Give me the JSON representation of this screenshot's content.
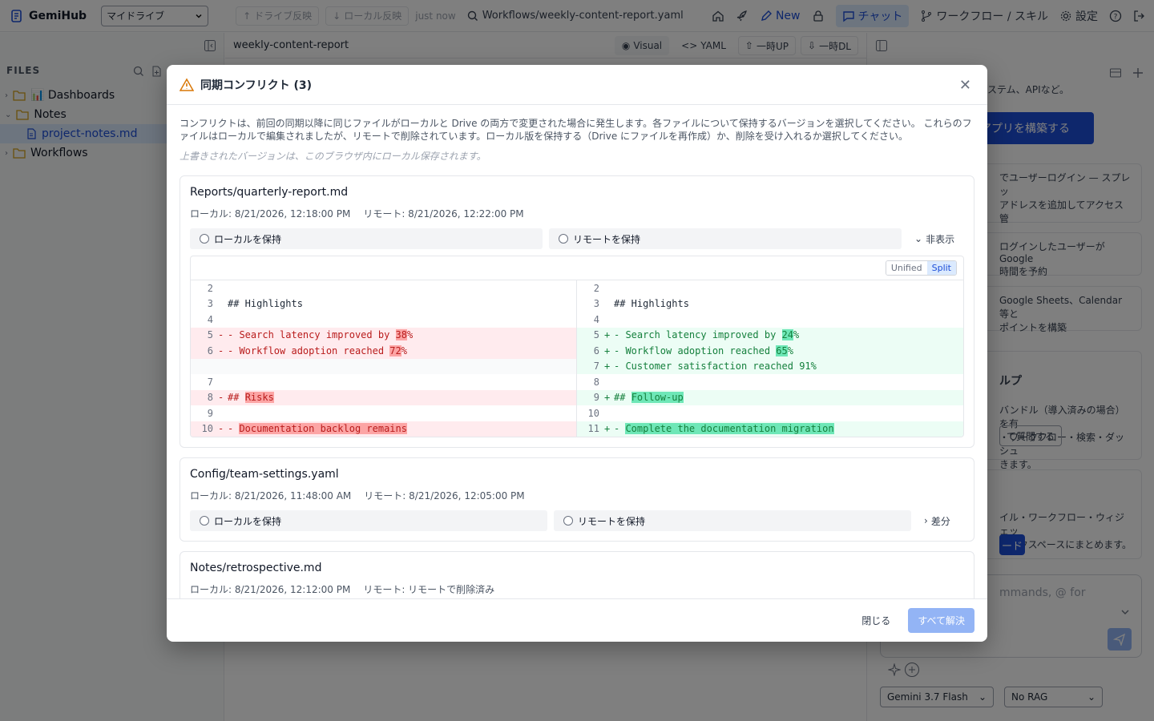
{
  "app": {
    "name": "GemiHub",
    "drive": "マイドライブ",
    "sync_down": "ドライブ反映",
    "sync_up": "ローカル反映",
    "sync_time": "just now",
    "path": "Workflows/weekly-content-report.yaml",
    "new_label": "New",
    "chat_label": "チャット",
    "workflow_label": "ワークフロー / スキル",
    "settings_label": "設定"
  },
  "sidebar": {
    "files_label": "FILES",
    "items": [
      {
        "label": "📊 Dashboards"
      },
      {
        "label": "Notes"
      },
      {
        "label": "project-notes.md"
      },
      {
        "label": "Workflows"
      }
    ]
  },
  "editor": {
    "file_name": "weekly-content-report",
    "visual_label": "Visual",
    "yaml_label": "YAML",
    "upload_label": "一時UP",
    "download_label": "一時DL"
  },
  "right_panel": {
    "text_top": "ステム、APIなど。",
    "build_button": "アプリを構築する",
    "card1": "でユーザーログイン — スプレッ\nアドレスを追加してアクセス管",
    "card2": "ログインしたユーザーがGoogle\n時間を予約",
    "card3": "Google Sheets、Calendar等と\nポイントを構築",
    "card4_title": "ルプ",
    "card4": "バンドル（導入済みの場合）を有\n・ワークフロー・検索・ダッシュ\nきます。",
    "card4_button": "て質問する",
    "card5": "イル・ワークフロー・ウィジェッ\nワークスペースにまとめます。",
    "card5_button": "ード",
    "input_placeholder": "mmands, @ for",
    "model": "Gemini 3.7 Flash",
    "rag": "No RAG"
  },
  "modal": {
    "title": "同期コンフリクト (3)",
    "description": "コンフリクトは、前回の同期以降に同じファイルがローカルと Drive の両方で変更された場合に発生します。各ファイルについて保持するバージョンを選択してください。 これらのファイルはローカルで編集されましたが、リモートで削除されています。ローカル版を保持する（Drive にファイルを再作成）か、削除を受け入れるか選択してください。",
    "note": "上書きされたバージョンは、このブラウザ内にローカル保存されます。",
    "keep_local": "ローカルを保持",
    "keep_remote": "リモートを保持",
    "hide_label": "非表示",
    "diff_label": "差分",
    "unified_label": "Unified",
    "split_label": "Split",
    "close_label": "閉じる",
    "resolve_all_label": "すべて解決",
    "conflicts": [
      {
        "path": "Reports/quarterly-report.md",
        "local": "ローカル: 8/21/2026, 12:18:00 PM",
        "remote": "リモート: 8/21/2026, 12:22:00 PM"
      },
      {
        "path": "Config/team-settings.yaml",
        "local": "ローカル: 8/21/2026, 11:48:00 AM",
        "remote": "リモート: 8/21/2026, 12:05:00 PM"
      },
      {
        "path": "Notes/retrospective.md",
        "local": "ローカル: 8/21/2026, 12:12:00 PM",
        "remote": "リモート: リモートで削除済み"
      }
    ],
    "diff_left": [
      {
        "n": "2",
        "t": "",
        "k": "ctx"
      },
      {
        "n": "3",
        "t": "## Highlights",
        "k": "ctx"
      },
      {
        "n": "4",
        "t": "",
        "k": "ctx"
      },
      {
        "n": "5",
        "pre": "- Search latency improved by ",
        "hl": "38",
        "post": "%",
        "k": "del"
      },
      {
        "n": "6",
        "pre": "- Workflow adoption reached ",
        "hl": "72",
        "post": "%",
        "k": "del"
      },
      {
        "n": "",
        "t": "",
        "k": "empty"
      },
      {
        "n": "7",
        "t": "",
        "k": "ctx"
      },
      {
        "n": "8",
        "pre": "## ",
        "hl": "Risks",
        "post": "",
        "k": "del"
      },
      {
        "n": "9",
        "t": "",
        "k": "ctx"
      },
      {
        "n": "10",
        "pre": "- ",
        "hl": "Documentation backlog remains",
        "post": "",
        "k": "del"
      }
    ],
    "diff_right": [
      {
        "n": "2",
        "t": "",
        "k": "ctx"
      },
      {
        "n": "3",
        "t": "## Highlights",
        "k": "ctx"
      },
      {
        "n": "4",
        "t": "",
        "k": "ctx"
      },
      {
        "n": "5",
        "pre": "- Search latency improved by ",
        "hl": "24",
        "post": "%",
        "k": "add"
      },
      {
        "n": "6",
        "pre": "- Workflow adoption reached ",
        "hl": "65",
        "post": "%",
        "k": "add"
      },
      {
        "n": "7",
        "pre": "- Customer satisfaction reached 91%",
        "hl": "",
        "post": "",
        "k": "add"
      },
      {
        "n": "8",
        "t": "",
        "k": "ctx"
      },
      {
        "n": "9",
        "pre": "## ",
        "hl": "Follow-up",
        "post": "",
        "k": "add"
      },
      {
        "n": "10",
        "t": "",
        "k": "ctx"
      },
      {
        "n": "11",
        "pre": "- ",
        "hl": "Complete the documentation migration",
        "post": "",
        "k": "add"
      }
    ]
  }
}
